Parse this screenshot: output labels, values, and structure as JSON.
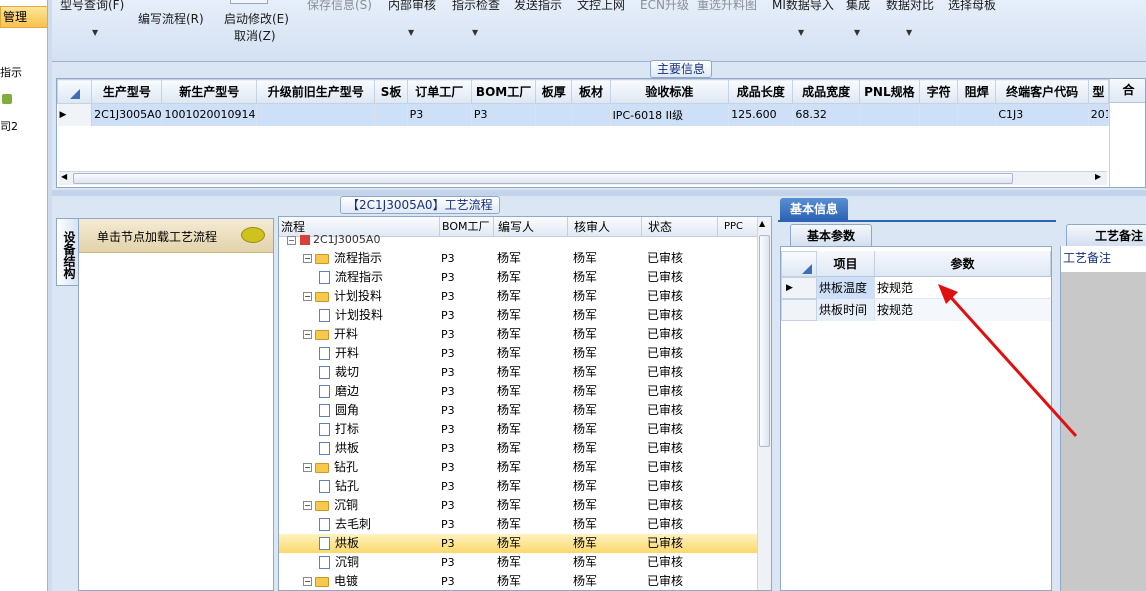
{
  "leftnav": {
    "selected": "管理",
    "items": [
      "指示",
      "司2"
    ]
  },
  "toolbar": {
    "model_query": "型号查询(F)",
    "edit_flow": "编写流程(R)",
    "start_modify": "启动修改(E)",
    "cancel": "取消(Z)",
    "save_info": "保存信息(S)",
    "internal_review": "内部审核",
    "instruction_check": "指示检查",
    "send_instruction": "发送指示",
    "doc_upload": "文控上网",
    "ecn_upgrade": "ECN升级",
    "select_upgrade_diagram": "重选升料图",
    "mi_import": "MI数据导入",
    "integrate": "集成",
    "data_compare": "数据对比",
    "select_master": "选择母板"
  },
  "main_info": {
    "caption": "主要信息",
    "columns": [
      "生产型号",
      "新生产型号",
      "升级前旧生产型号",
      "S板",
      "订单工厂",
      "BOM工厂",
      "板厚",
      "板材",
      "验收标准",
      "成品长度",
      "成品宽度",
      "PNL规格",
      "字符",
      "阻焊",
      "终端客户代码",
      "型"
    ],
    "row": [
      "2C1J3005A0",
      "10010200109146",
      "",
      "",
      "P3",
      "P3",
      "",
      "",
      "IPC-6018 II级",
      "125.600",
      "68.32",
      "",
      "",
      "",
      "C1J3",
      "201"
    ],
    "right_header": "合"
  },
  "device_structure": {
    "tab_label": "设备结构",
    "hint": "单击节点加载工艺流程"
  },
  "process_flow": {
    "caption": "【2C1J3005A0】工艺流程",
    "columns": [
      "流程",
      "BOM工厂",
      "编写人",
      "核审人",
      "状态",
      "PPC"
    ],
    "root": "2C1J3005A0",
    "rows": [
      {
        "name": "流程指示",
        "level": 1,
        "folder": true,
        "bom": "P3",
        "writer": "杨军",
        "reviewer": "杨军",
        "status": "已审核"
      },
      {
        "name": "流程指示",
        "level": 2,
        "folder": false,
        "bom": "P3",
        "writer": "杨军",
        "reviewer": "杨军",
        "status": "已审核"
      },
      {
        "name": "计划投料",
        "level": 1,
        "folder": true,
        "bom": "P3",
        "writer": "杨军",
        "reviewer": "杨军",
        "status": "已审核"
      },
      {
        "name": "计划投料",
        "level": 2,
        "folder": false,
        "bom": "P3",
        "writer": "杨军",
        "reviewer": "杨军",
        "status": "已审核"
      },
      {
        "name": "开料",
        "level": 1,
        "folder": true,
        "bom": "P3",
        "writer": "杨军",
        "reviewer": "杨军",
        "status": "已审核"
      },
      {
        "name": "开料",
        "level": 2,
        "folder": false,
        "bom": "P3",
        "writer": "杨军",
        "reviewer": "杨军",
        "status": "已审核"
      },
      {
        "name": "裁切",
        "level": 2,
        "folder": false,
        "bom": "P3",
        "writer": "杨军",
        "reviewer": "杨军",
        "status": "已审核"
      },
      {
        "name": "磨边",
        "level": 2,
        "folder": false,
        "bom": "P3",
        "writer": "杨军",
        "reviewer": "杨军",
        "status": "已审核"
      },
      {
        "name": "圆角",
        "level": 2,
        "folder": false,
        "bom": "P3",
        "writer": "杨军",
        "reviewer": "杨军",
        "status": "已审核"
      },
      {
        "name": "打标",
        "level": 2,
        "folder": false,
        "bom": "P3",
        "writer": "杨军",
        "reviewer": "杨军",
        "status": "已审核"
      },
      {
        "name": "烘板",
        "level": 2,
        "folder": false,
        "bom": "P3",
        "writer": "杨军",
        "reviewer": "杨军",
        "status": "已审核"
      },
      {
        "name": "钻孔",
        "level": 1,
        "folder": true,
        "bom": "P3",
        "writer": "杨军",
        "reviewer": "杨军",
        "status": "已审核"
      },
      {
        "name": "钻孔",
        "level": 2,
        "folder": false,
        "bom": "P3",
        "writer": "杨军",
        "reviewer": "杨军",
        "status": "已审核"
      },
      {
        "name": "沉铜",
        "level": 1,
        "folder": true,
        "bom": "P3",
        "writer": "杨军",
        "reviewer": "杨军",
        "status": "已审核"
      },
      {
        "name": "去毛刺",
        "level": 2,
        "folder": false,
        "bom": "P3",
        "writer": "杨军",
        "reviewer": "杨军",
        "status": "已审核"
      },
      {
        "name": "烘板",
        "level": 2,
        "folder": false,
        "bom": "P3",
        "writer": "杨军",
        "reviewer": "杨军",
        "status": "已审核",
        "selected": true
      },
      {
        "name": "沉铜",
        "level": 2,
        "folder": false,
        "bom": "P3",
        "writer": "杨军",
        "reviewer": "杨军",
        "status": "已审核"
      },
      {
        "name": "电镀",
        "level": 1,
        "folder": true,
        "bom": "P3",
        "writer": "杨军",
        "reviewer": "杨军",
        "status": "已审核"
      }
    ]
  },
  "basic_info": {
    "tab": "基本信息",
    "subtab": "基本参数",
    "columns": [
      "项目",
      "参数"
    ],
    "rows": [
      {
        "item": "烘板温度",
        "param": "按规范"
      },
      {
        "item": "烘板时间",
        "param": "按规范"
      }
    ],
    "annotation_color": "#e01010"
  },
  "process_notes": {
    "tab": "工艺备注",
    "label": "工艺备注"
  }
}
